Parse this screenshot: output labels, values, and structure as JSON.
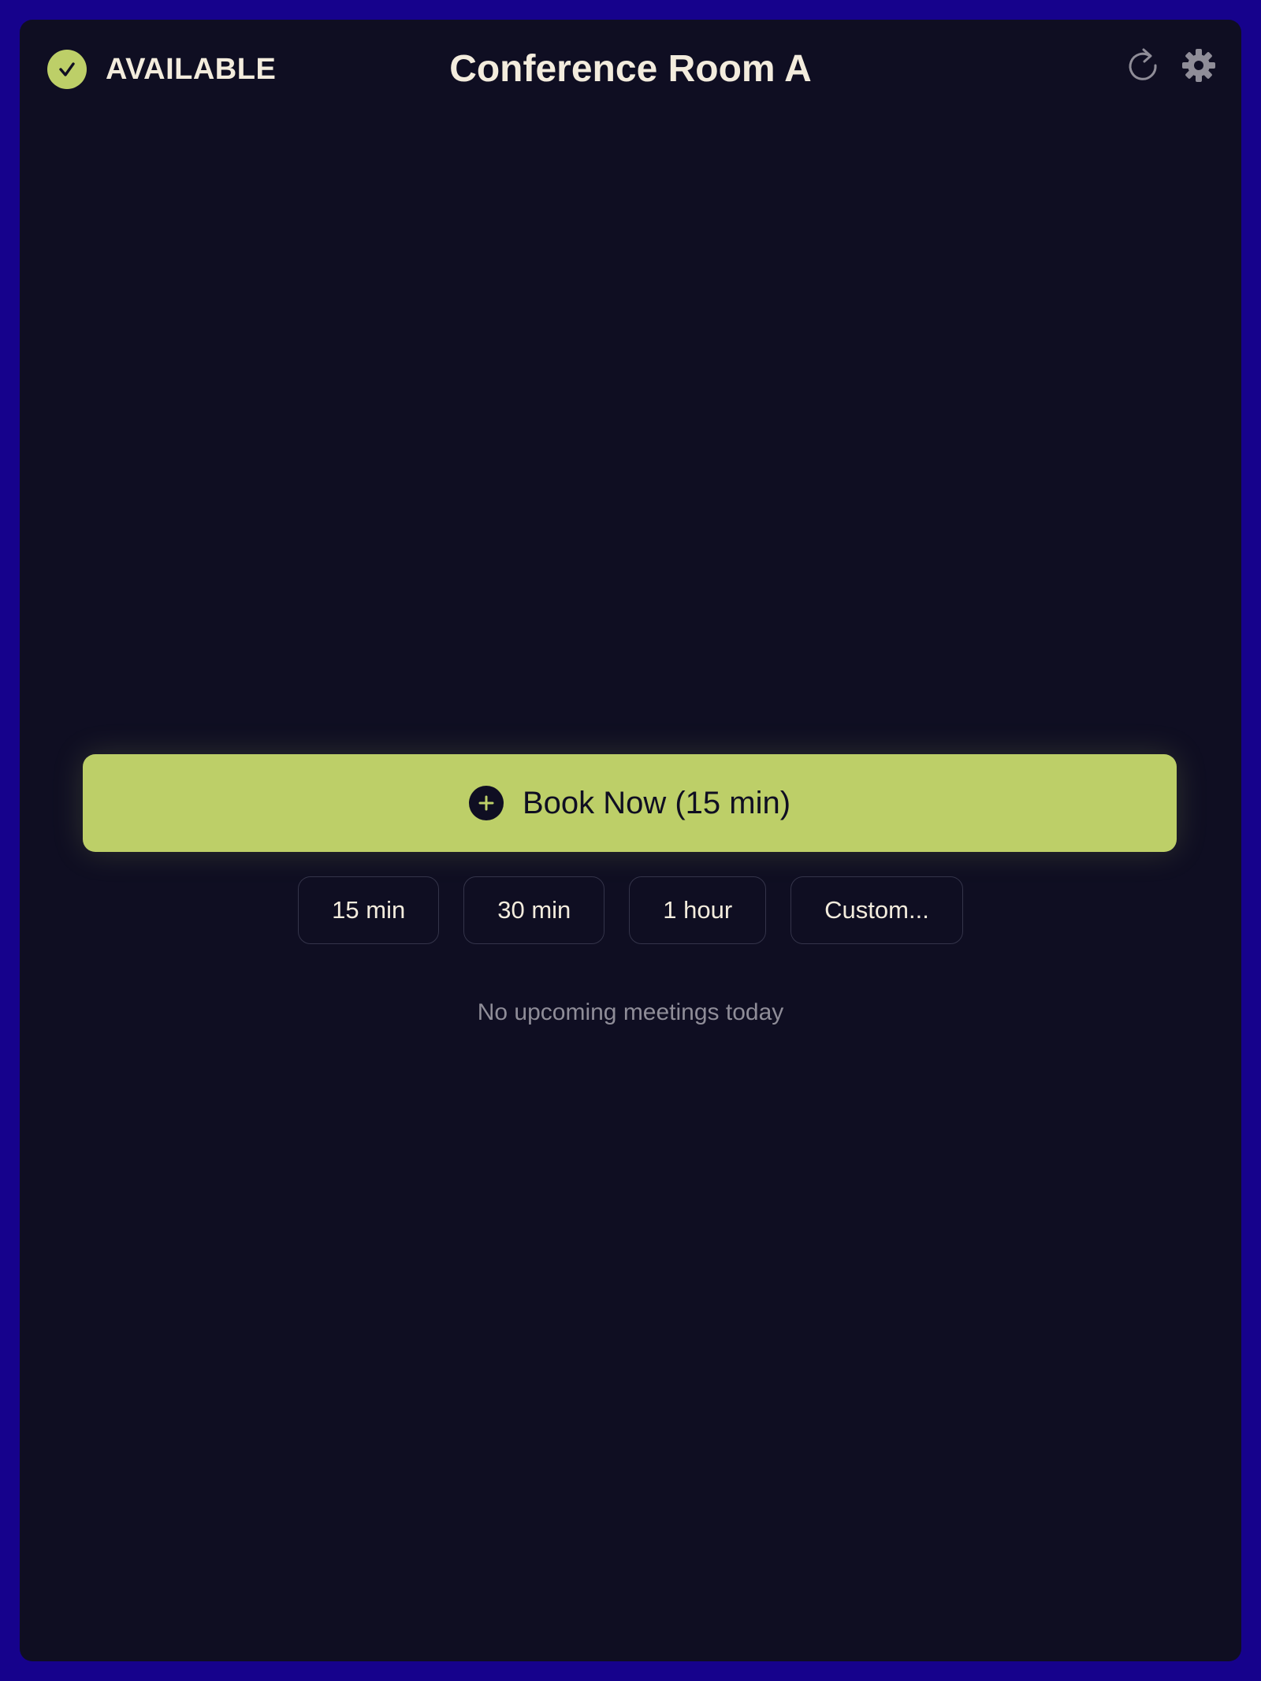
{
  "header": {
    "status_label": "AVAILABLE",
    "room_name": "Conference Room A",
    "icons": {
      "status": "checkmark-circle-icon",
      "refresh": "refresh-icon",
      "settings": "gear-icon"
    }
  },
  "booking": {
    "book_now_label": "Book Now (15 min)",
    "book_now_icon": "plus-circle-icon",
    "durations": [
      "15 min",
      "30 min",
      "1 hour",
      "Custom..."
    ]
  },
  "schedule": {
    "empty_message": "No upcoming meetings today"
  },
  "colors": {
    "frame": "#16028c",
    "background": "#0f0e22",
    "accent": "#bdcf68",
    "text": "#f3ecdd",
    "muted_text": "#8f8d98"
  }
}
